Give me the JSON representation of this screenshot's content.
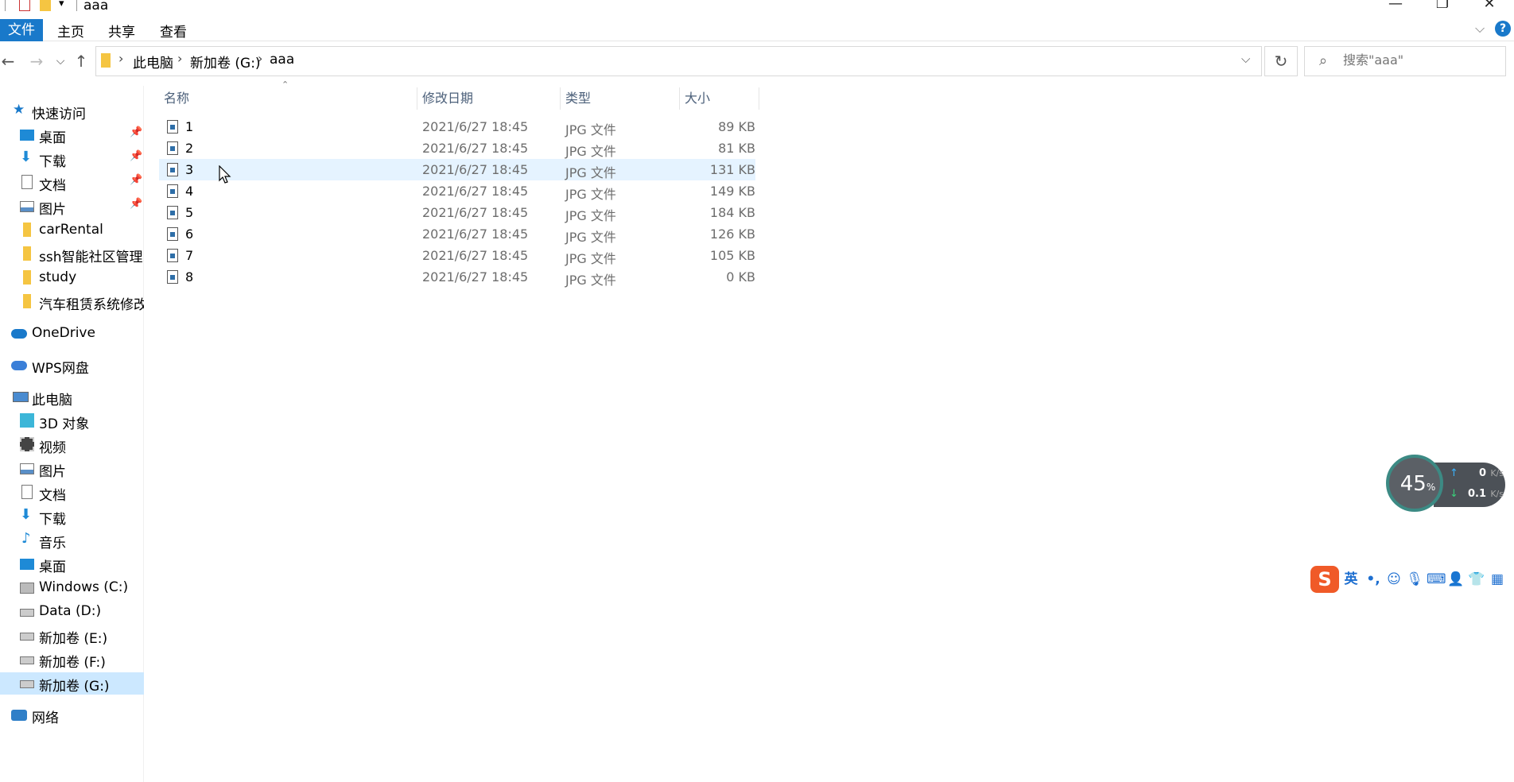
{
  "window": {
    "title": "aaa",
    "minimize": "—",
    "restore": "❐",
    "close": "✕"
  },
  "ribbon": {
    "tabs": [
      "文件",
      "主页",
      "共享",
      "查看"
    ],
    "expand_icon": "chevron-down-icon",
    "help_icon": "help-icon"
  },
  "address": {
    "crumbs": [
      "此电脑",
      "新加卷 (G:)",
      "aaa"
    ]
  },
  "search": {
    "placeholder": "搜索\"aaa\""
  },
  "sidebar": {
    "quick_access": "快速访问",
    "pinned": [
      {
        "label": "桌面",
        "icon": "desktop-icon"
      },
      {
        "label": "下载",
        "icon": "download-icon"
      },
      {
        "label": "文档",
        "icon": "document-icon"
      },
      {
        "label": "图片",
        "icon": "pictures-icon"
      }
    ],
    "folders": [
      "carRental",
      "ssh智能社区管理系",
      "study",
      "汽车租赁系统修改"
    ],
    "onedrive": "OneDrive",
    "wps": "WPS网盘",
    "this_pc": "此电脑",
    "pc_items": [
      {
        "label": "3D 对象",
        "icon": "3d-objects-icon"
      },
      {
        "label": "视频",
        "icon": "video-icon"
      },
      {
        "label": "图片",
        "icon": "pictures-icon"
      },
      {
        "label": "文档",
        "icon": "document-icon"
      },
      {
        "label": "下载",
        "icon": "download-icon"
      },
      {
        "label": "音乐",
        "icon": "music-icon"
      },
      {
        "label": "桌面",
        "icon": "desktop-icon"
      },
      {
        "label": "Windows (C:)",
        "icon": "windows-drive-icon"
      },
      {
        "label": "Data (D:)",
        "icon": "drive-icon"
      },
      {
        "label": "新加卷 (E:)",
        "icon": "drive-icon"
      },
      {
        "label": "新加卷 (F:)",
        "icon": "drive-icon"
      },
      {
        "label": "新加卷 (G:)",
        "icon": "drive-icon"
      }
    ],
    "network": "网络"
  },
  "columns": {
    "name": "名称",
    "date": "修改日期",
    "type": "类型",
    "size": "大小"
  },
  "files": [
    {
      "name": "1",
      "date": "2021/6/27 18:45",
      "type": "JPG 文件",
      "size": "89 KB"
    },
    {
      "name": "2",
      "date": "2021/6/27 18:45",
      "type": "JPG 文件",
      "size": "81 KB"
    },
    {
      "name": "3",
      "date": "2021/6/27 18:45",
      "type": "JPG 文件",
      "size": "131 KB"
    },
    {
      "name": "4",
      "date": "2021/6/27 18:45",
      "type": "JPG 文件",
      "size": "149 KB"
    },
    {
      "name": "5",
      "date": "2021/6/27 18:45",
      "type": "JPG 文件",
      "size": "184 KB"
    },
    {
      "name": "6",
      "date": "2021/6/27 18:45",
      "type": "JPG 文件",
      "size": "126 KB"
    },
    {
      "name": "7",
      "date": "2021/6/27 18:45",
      "type": "JPG 文件",
      "size": "105 KB"
    },
    {
      "name": "8",
      "date": "2021/6/27 18:45",
      "type": "JPG 文件",
      "size": "0 KB"
    }
  ],
  "widget": {
    "percent": "45",
    "percent_unit": "%",
    "upload": "0",
    "download": "0.1",
    "unit": "K/s"
  },
  "ime": {
    "logo": "S",
    "mode": "英",
    "punct": "•,"
  }
}
